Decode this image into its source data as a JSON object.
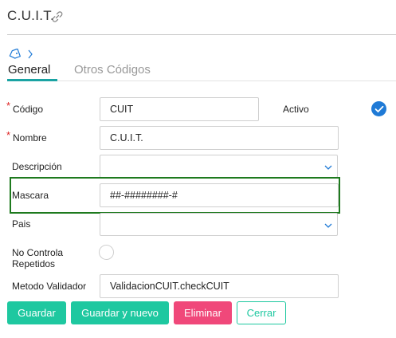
{
  "header": {
    "title": "C.U.I.T.",
    "link_icon": "link-icon",
    "tag_icon": "tag-icon",
    "chevron_icon": "chevron-right-icon"
  },
  "tabs": [
    {
      "label": "General",
      "active": true
    },
    {
      "label": "Otros Códigos",
      "active": false
    }
  ],
  "form": {
    "codigo": {
      "label": "Código",
      "required": true,
      "value": "CUIT"
    },
    "activo": {
      "label": "Activo",
      "checked": true
    },
    "nombre": {
      "label": "Nombre",
      "required": true,
      "value": "C.U.I.T."
    },
    "descripcion": {
      "label": "Descripción",
      "value": ""
    },
    "mascara": {
      "label": "Mascara",
      "value": "##-########-#"
    },
    "pais": {
      "label": "Pais",
      "value": ""
    },
    "no_controla": {
      "label_line1": "No Controla",
      "label_line2": "Repetidos",
      "checked": false
    },
    "metodo": {
      "label": "Metodo Validador",
      "value": "ValidacionCUIT.checkCUIT"
    },
    "required_mark": "*"
  },
  "buttons": {
    "guardar": "Guardar",
    "guardar_nuevo": "Guardar y nuevo",
    "eliminar": "Eliminar",
    "cerrar": "Cerrar"
  },
  "colors": {
    "accent": "#1ec8a0",
    "danger": "#f0487a",
    "tab_underline": "#1aa3a3",
    "check": "#1f7ad6",
    "highlight": "#1e7a1e",
    "required": "#dd2222"
  }
}
